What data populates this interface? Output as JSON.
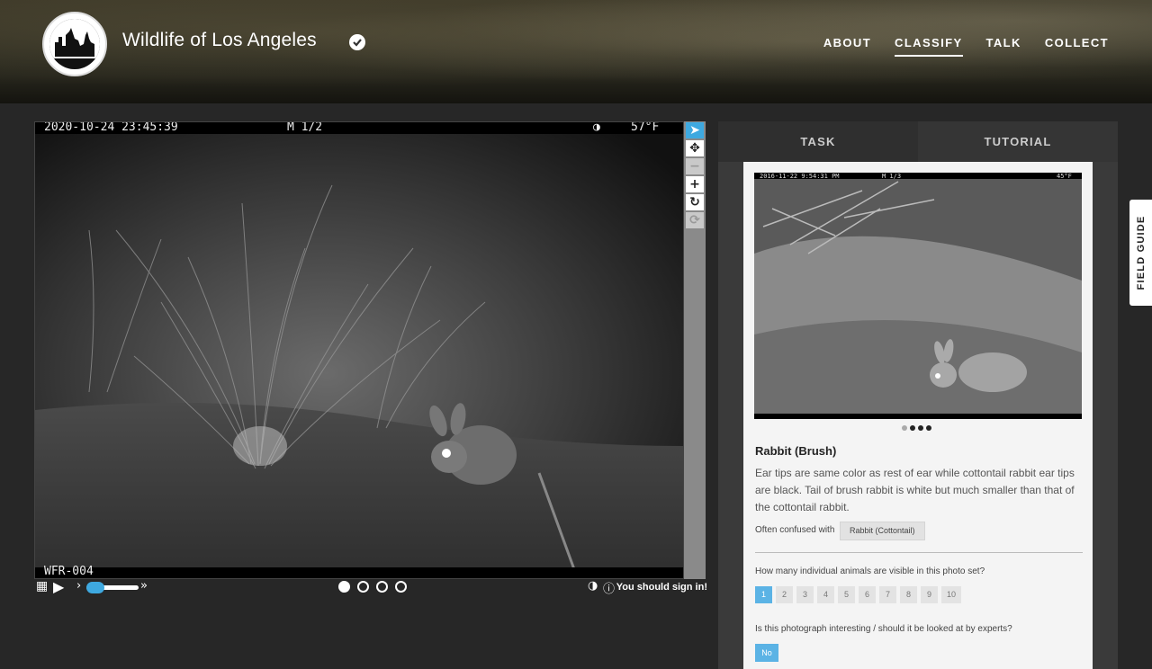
{
  "header": {
    "title": "Wildlife of Los Angeles",
    "nav": [
      "ABOUT",
      "CLASSIFY",
      "TALK",
      "COLLECT"
    ],
    "active_nav": "CLASSIFY"
  },
  "viewer": {
    "timestamp": "2020-10-24 23:45:39",
    "frame": "M 1/2",
    "temperature": "57°F",
    "camera_id": "WFR-004",
    "frames_total": 4,
    "current_frame": 1,
    "signin_text": "You should sign in!"
  },
  "tools": [
    "pointer-icon",
    "move-icon",
    "zoom-out-icon",
    "zoom-in-icon",
    "rotate-icon",
    "reset-icon"
  ],
  "panel": {
    "tabs": [
      "TASK",
      "TUTORIAL"
    ],
    "example": {
      "timestamp": "2016-11-22 9:54:31 PM",
      "frame": "M 1/3",
      "temperature": "45°F",
      "dots_total": 4
    },
    "species": "Rabbit (Brush)",
    "description": "Ear tips are same color as rest of ear while cottontail rabbit ear tips are black. Tail of brush rabbit is white but much smaller than that of the cottontail rabbit.",
    "confused_label": "Often confused with",
    "confused_with": "Rabbit (Cottontail)",
    "question_count": "How many individual animals are visible in this photo set?",
    "counts": [
      "1",
      "2",
      "3",
      "4",
      "5",
      "6",
      "7",
      "8",
      "9",
      "10"
    ],
    "selected_count": "1",
    "question_interesting": "Is this photograph interesting / should it be looked at by experts?",
    "interesting_answer": "No"
  },
  "field_guide": "FIELD GUIDE",
  "colors": {
    "accent": "#5bb3e5",
    "tool_active": "#3ea9e0",
    "background": "#272727"
  }
}
